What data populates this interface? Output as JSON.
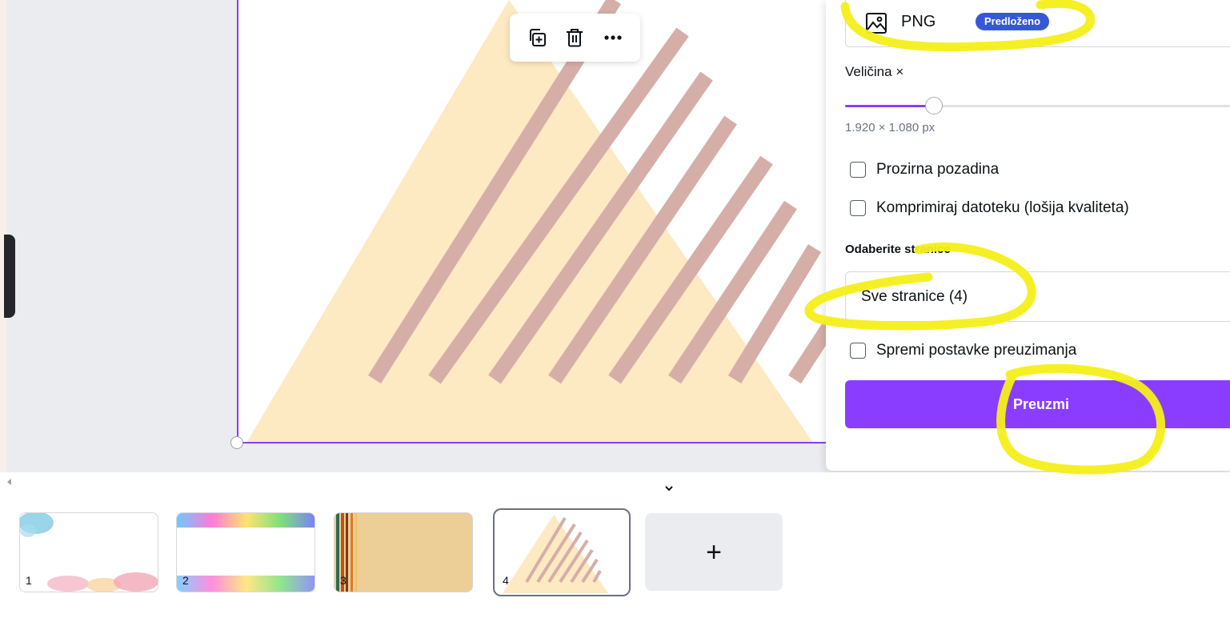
{
  "toolbar": {
    "duplicate_icon": "duplicate-page-icon",
    "delete_icon": "trash-icon",
    "more_icon": "more-options-icon"
  },
  "download_panel": {
    "file_type": {
      "icon": "image-icon",
      "label": "PNG",
      "badge": "Predloženo"
    },
    "size": {
      "label": "Veličina ×",
      "slider_fraction": 0.23,
      "dimensions": "1.920 × 1.080 px"
    },
    "options": [
      {
        "label": "Prozirna pozadina",
        "checked": false
      },
      {
        "label": "Komprimiraj datoteku (lošija kvaliteta)",
        "checked": false
      }
    ],
    "pages": {
      "label": "Odaberite stranice",
      "value": "Sve stranice (4)"
    },
    "save_settings": {
      "label": "Spremi postavke preuzimanja",
      "checked": false
    },
    "download_button": "Preuzmi"
  },
  "page_strip": {
    "pages": [
      {
        "number": "1"
      },
      {
        "number": "2"
      },
      {
        "number": "3"
      },
      {
        "number": "4",
        "selected": true
      }
    ],
    "add_page": "+"
  },
  "colors": {
    "accent": "#8b3dff",
    "badge": "#3658d6",
    "triangle": "#fde9c2",
    "stripes": "#d6aea8",
    "highlighter": "#f4ef1a"
  }
}
